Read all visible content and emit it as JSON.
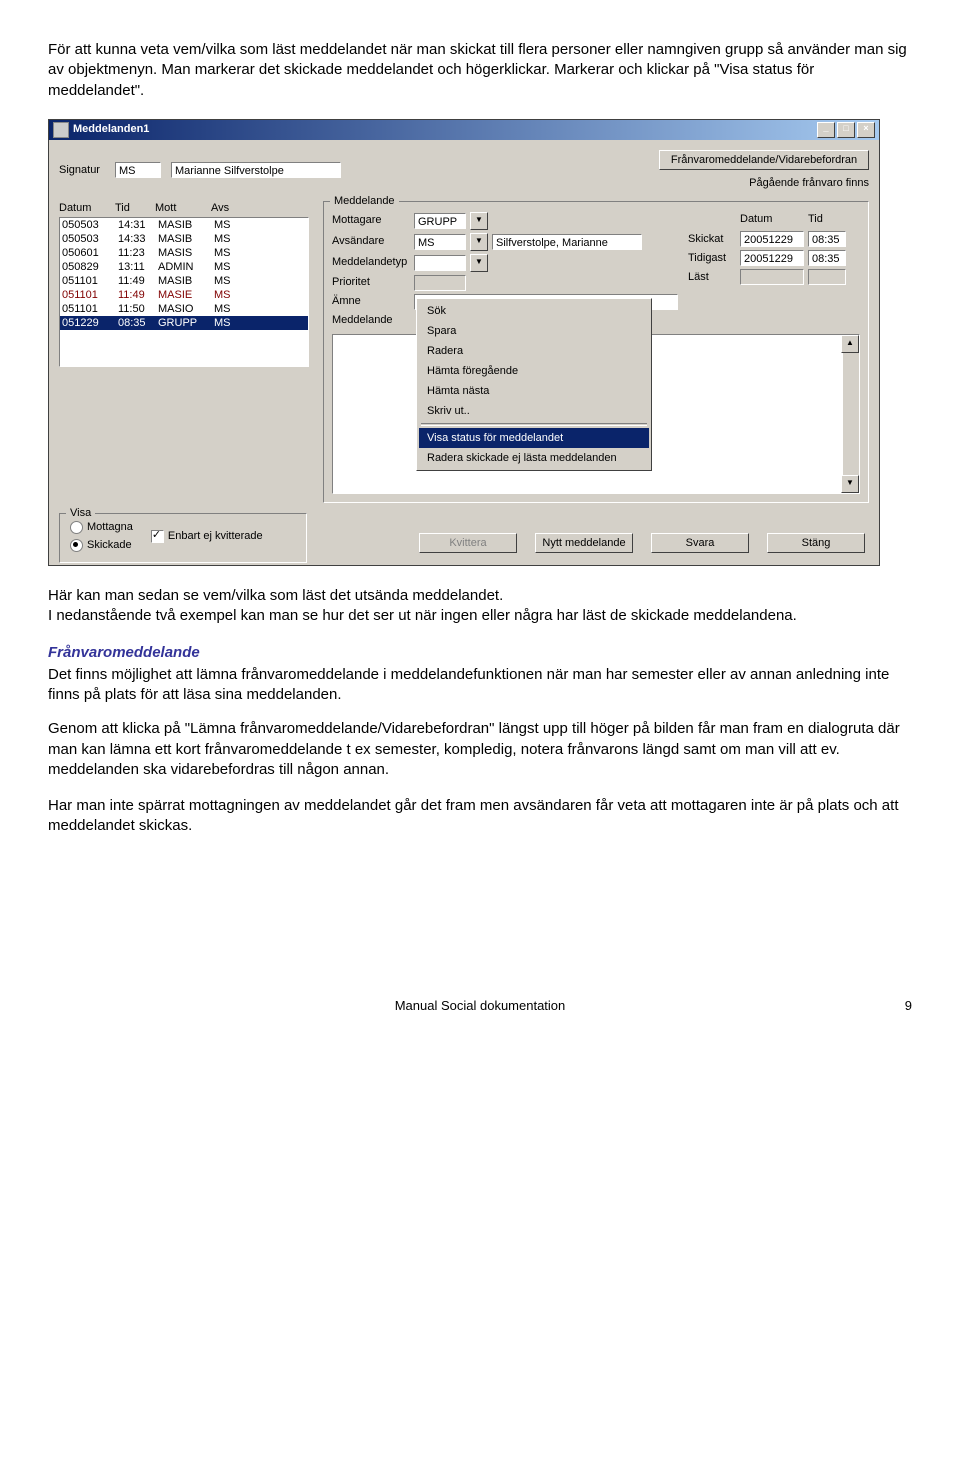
{
  "intro": {
    "p1": "För att kunna veta vem/vilka som läst meddelandet när man skickat till flera personer eller namngiven grupp så använder man sig av objektmenyn. Man markerar det skickade meddelandet och högerklickar. Markerar och klickar på \"Visa status för meddelandet\"."
  },
  "window": {
    "title": "Meddelanden1",
    "signatur_label": "Signatur",
    "signatur_value": "MS",
    "signatur_name": "Marianne Silfverstolpe",
    "frv_button": "Frånvaromeddelande/Vidarebefordran",
    "frv_status": "Pågående frånvaro finns",
    "cols": {
      "datum": "Datum",
      "tid": "Tid",
      "mott": "Mott",
      "avs": "Avs"
    },
    "rows": [
      {
        "d": "050503",
        "t": "14:31",
        "m": "MASIB",
        "a": "MS",
        "style": ""
      },
      {
        "d": "050503",
        "t": "14:33",
        "m": "MASIB",
        "a": "MS",
        "style": ""
      },
      {
        "d": "050601",
        "t": "11:23",
        "m": "MASIS",
        "a": "MS",
        "style": ""
      },
      {
        "d": "050829",
        "t": "13:11",
        "m": "ADMIN",
        "a": "MS",
        "style": ""
      },
      {
        "d": "051101",
        "t": "11:49",
        "m": "MASIB",
        "a": "MS",
        "style": ""
      },
      {
        "d": "051101",
        "t": "11:49",
        "m": "MASIE",
        "a": "MS",
        "style": "red"
      },
      {
        "d": "051101",
        "t": "11:50",
        "m": "MASIO",
        "a": "MS",
        "style": ""
      },
      {
        "d": "051229",
        "t": "08:35",
        "m": "GRUPP",
        "a": "MS",
        "style": "sel"
      }
    ],
    "meddelande": {
      "legend": "Meddelande",
      "mottagare_lbl": "Mottagare",
      "mottagare_val": "GRUPP",
      "avsandare_lbl": "Avsändare",
      "avsandare_val": "MS",
      "avsandare_name": "Silfverstolpe, Marianne",
      "medtyp_lbl": "Meddelandetyp",
      "medtyp_val": "",
      "prioritet_lbl": "Prioritet",
      "amne_lbl": "Ämne",
      "body_lbl": "Meddelande"
    },
    "right": {
      "datum_lbl": "Datum",
      "tid_lbl": "Tid",
      "skickat_lbl": "Skickat",
      "skickat_date": "20051229",
      "skickat_tid": "08:35",
      "tidigast_lbl": "Tidigast",
      "tidigast_date": "20051229",
      "tidigast_tid": "08:35",
      "last_lbl": "Läst"
    },
    "context_menu": {
      "items_a": [
        "Sök",
        "Spara",
        "Radera",
        "Hämta föregående",
        "Hämta nästa",
        "Skriv ut.."
      ],
      "item_sel": "Visa status för meddelandet",
      "item_after": "Radera skickade ej lästa meddelanden"
    },
    "visa": {
      "legend": "Visa",
      "mottagna": "Mottagna",
      "skickade": "Skickade",
      "enbart": "Enbart ej kvitterade"
    },
    "buttons": {
      "kvittera": "Kvittera",
      "nytt": "Nytt meddelande",
      "svara": "Svara",
      "stang": "Stäng"
    }
  },
  "midtext": {
    "p1": "Här kan man sedan se vem/vilka som läst det utsända meddelandet.",
    "p2": "I nedanstående två exempel kan man se hur det ser ut när ingen eller några har läst de skickade meddelandena."
  },
  "subheading": "Frånvaromeddelande",
  "body": {
    "p1": "Det finns möjlighet att lämna frånvaromeddelande i meddelandefunktionen när man har semester eller av annan anledning inte finns på plats för att läsa sina meddelanden.",
    "p2": "Genom att klicka på \"Lämna frånvaromeddelande/Vidarebefordran\" längst upp till höger på bilden får man fram en dialogruta där man kan lämna ett kort frånvaromeddelande t ex semester, kompledig, notera frånvarons längd samt om man vill att ev. meddelanden ska vidarebefordras till någon annan.",
    "p3": "Har man inte spärrat mottagningen av meddelandet går det fram men avsändaren får veta att mottagaren inte är på plats och att meddelandet skickas."
  },
  "footer": {
    "center": "Manual Social dokumentation",
    "page": "9"
  }
}
